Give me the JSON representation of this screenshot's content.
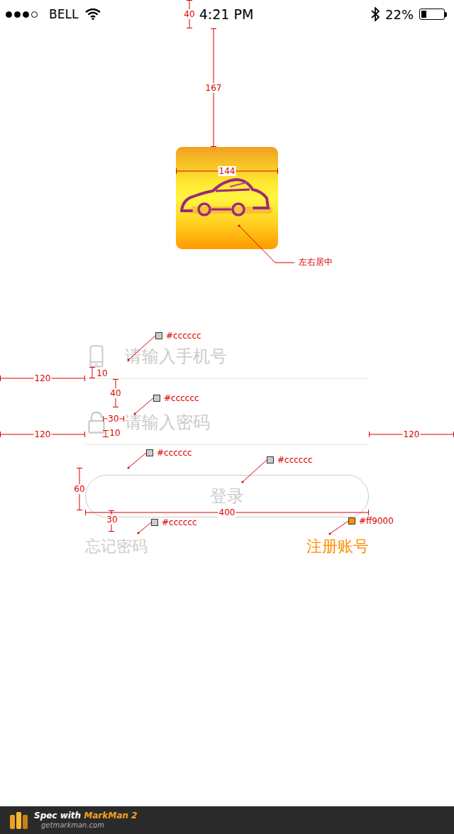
{
  "status_bar": {
    "signal": [
      {
        "on": true
      },
      {
        "on": true
      },
      {
        "on": true
      },
      {
        "on": false
      }
    ],
    "carrier": "BELL",
    "time": "4:21 PM",
    "battery": "22%",
    "battery_level": 0.22
  },
  "login": {
    "phone_placeholder": "请输入手机号",
    "password_placeholder": "请输入密码",
    "button": "登录",
    "forgot": "忘记密码",
    "register": "注册账号"
  },
  "annotations": {
    "dimensions": [
      {
        "label": "40"
      },
      {
        "label": "167"
      },
      {
        "label": "144"
      },
      {
        "label": "120"
      },
      {
        "label": "10"
      },
      {
        "label": "40"
      },
      {
        "label": "30"
      },
      {
        "label": "10"
      },
      {
        "label": "120"
      },
      {
        "label": "120"
      },
      {
        "label": "60"
      },
      {
        "label": "400"
      },
      {
        "label": "30"
      }
    ],
    "note": "左右居中",
    "color_tags": [
      {
        "label": "#cccccc",
        "color": "#cccccc"
      },
      {
        "label": "#cccccc",
        "color": "#cccccc"
      },
      {
        "label": "#cccccc",
        "color": "#cccccc"
      },
      {
        "label": "#cccccc",
        "color": "#cccccc"
      },
      {
        "label": "#cccccc",
        "color": "#cccccc"
      },
      {
        "label": "#ff9000",
        "color": "#ff9000"
      }
    ]
  },
  "footer": {
    "prefix": "Spec with",
    "brand": "MarkMan 2",
    "url": "getmarkman.com"
  }
}
